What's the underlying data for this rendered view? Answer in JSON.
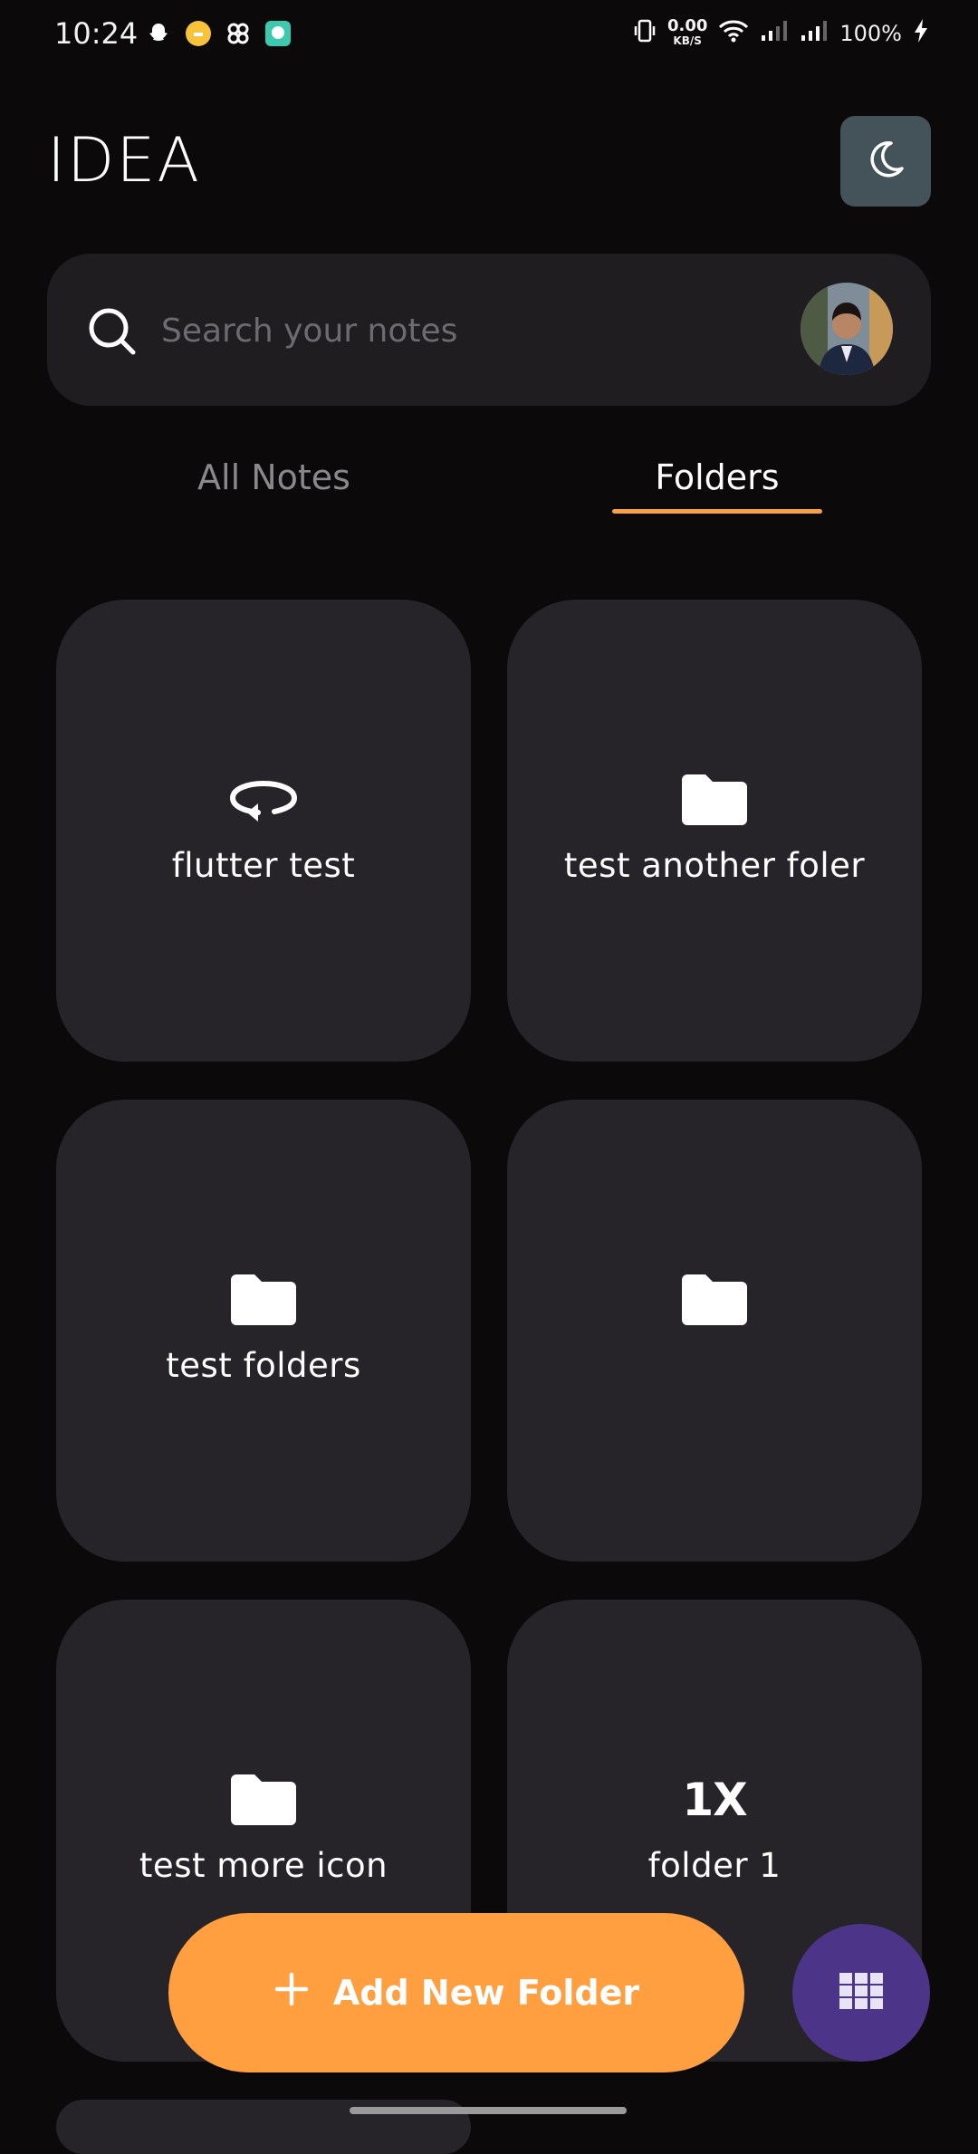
{
  "status_bar": {
    "time": "10:24",
    "speed_value": "0.00",
    "speed_unit": "KB/S",
    "battery": "100%"
  },
  "header": {
    "title": "IDEA",
    "theme_icon": "moon-icon"
  },
  "search": {
    "placeholder": "Search your notes",
    "value": ""
  },
  "tabs": {
    "all_notes": "All Notes",
    "folders": "Folders",
    "active": "folders"
  },
  "folders": [
    {
      "name": "flutter test",
      "icon": "rotate-icon"
    },
    {
      "name": "test another foler",
      "icon": "folder-icon"
    },
    {
      "name": "test folders",
      "icon": "folder-icon"
    },
    {
      "name": "",
      "icon": "folder-icon"
    },
    {
      "name": "test more icon",
      "icon": "folder-icon"
    },
    {
      "name": "folder 1",
      "icon": "1x-icon",
      "icon_text": "1X"
    }
  ],
  "actions": {
    "add_folder_label": "Add New Folder",
    "add_icon": "plus-icon",
    "layout_icon": "grid-icon"
  },
  "colors": {
    "background": "#0b090a",
    "card": "#262428",
    "accent_orange": "#ff9f40",
    "accent_purple": "#4c3489",
    "theme_button": "#435359"
  }
}
